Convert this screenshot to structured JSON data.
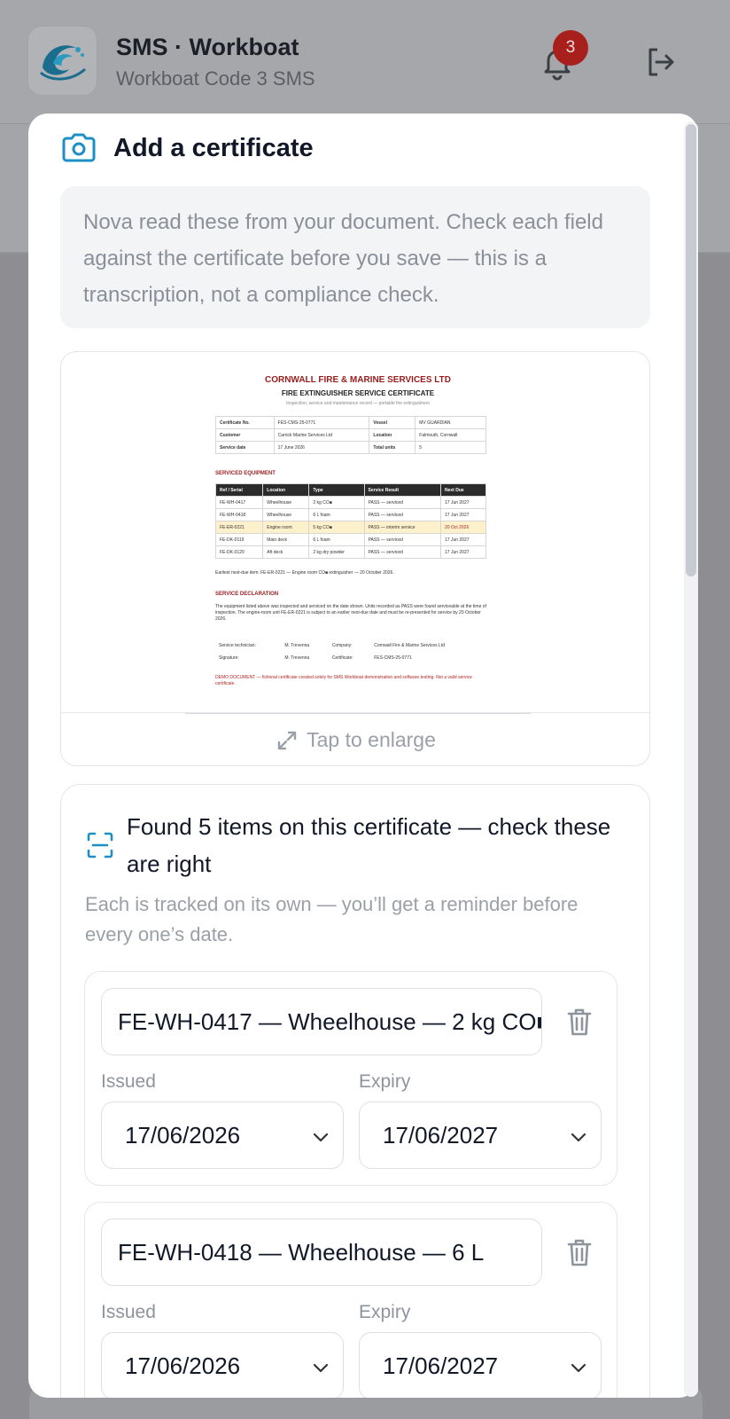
{
  "app": {
    "title": "SMS · Workboat",
    "subtitle": "Workboat Code 3 SMS",
    "notification_count": "3"
  },
  "modal": {
    "title": "Add a certificate",
    "notice": "Nova read these from your document. Check each field against the certificate before you save — this is a transcription, not a compliance check.",
    "enlarge_label": "Tap to enlarge"
  },
  "document": {
    "company": "CORNWALL FIRE & MARINE SERVICES LTD",
    "title": "FIRE EXTINGUISHER SERVICE CERTIFICATE",
    "subtitle": "Inspection, service and maintenance record — portable fire extinguishers",
    "info": [
      [
        "Certificate No.",
        "FES-CMS-25-0771",
        "Vessel",
        "MV GUARDIAN"
      ],
      [
        "Customer",
        "Carrick Marine Services Ltd",
        "Location",
        "Falmouth, Cornwall"
      ],
      [
        "Service date",
        "17 June 2026",
        "Total units",
        "5"
      ]
    ],
    "equipment_heading": "SERVICED EQUIPMENT",
    "equipment_columns": [
      "Ref / Serial",
      "Location",
      "Type",
      "Service Result",
      "Next Due"
    ],
    "equipment_rows": [
      [
        "FE-WH-0417",
        "Wheelhouse",
        "2 kg CO■",
        "PASS — serviced",
        "17 Jun 2027"
      ],
      [
        "FE-WH-0418",
        "Wheelhouse",
        "6 L foam",
        "PASS — serviced",
        "17 Jun 2027"
      ],
      [
        "FE-ER-0221",
        "Engine room",
        "5 kg CO■",
        "PASS — interim service",
        "20 Oct 2026"
      ],
      [
        "FE-DK-0119",
        "Main deck",
        "6 L foam",
        "PASS — serviced",
        "17 Jun 2027"
      ],
      [
        "FE-DK-0120",
        "Aft deck",
        "2 kg dry powder",
        "PASS — serviced",
        "17 Jun 2027"
      ]
    ],
    "earliest_due": "Earliest next-due item: FE-ER-0221 — Engine room CO■ extinguisher — 20 October 2026.",
    "declaration_heading": "SERVICE DECLARATION",
    "declaration": "The equipment listed above was inspected and serviced on the date shown. Units recorded as PASS were found serviceable at the time of inspection. The engine-room unit FE-ER-0221 is subject to an earlier next-due date and must be re-presented for service by 20 October 2026.",
    "signatures": [
      [
        "Service technician:",
        "M. Trevenna",
        "Company:",
        "Cornwall Fire & Marine Services Ltd"
      ],
      [
        "Signature:",
        "M. Trevenna",
        "Certificate:",
        "FES-CMS-25-0771"
      ]
    ],
    "disclaimer": "DEMO DOCUMENT — fictional certificate created solely for SMS Workboat demonstration and software testing. Not a valid service certificate."
  },
  "found": {
    "title": "Found 5 items on this certificate — check these are right",
    "subtitle": "Each is tracked on its own — you’ll get a reminder before every one’s date.",
    "issued_label": "Issued",
    "expiry_label": "Expiry",
    "items": [
      {
        "name": "FE-WH-0417 — Wheelhouse — 2 kg CO■",
        "issued": "17/06/2026",
        "expiry": "17/06/2027"
      },
      {
        "name": "FE-WH-0418 — Wheelhouse — 6 L",
        "issued": "17/06/2026",
        "expiry": "17/06/2027"
      }
    ]
  },
  "colors": {
    "accent": "#1e8fc4",
    "badge": "#a8201c",
    "brand_red": "#9a1d1d"
  }
}
